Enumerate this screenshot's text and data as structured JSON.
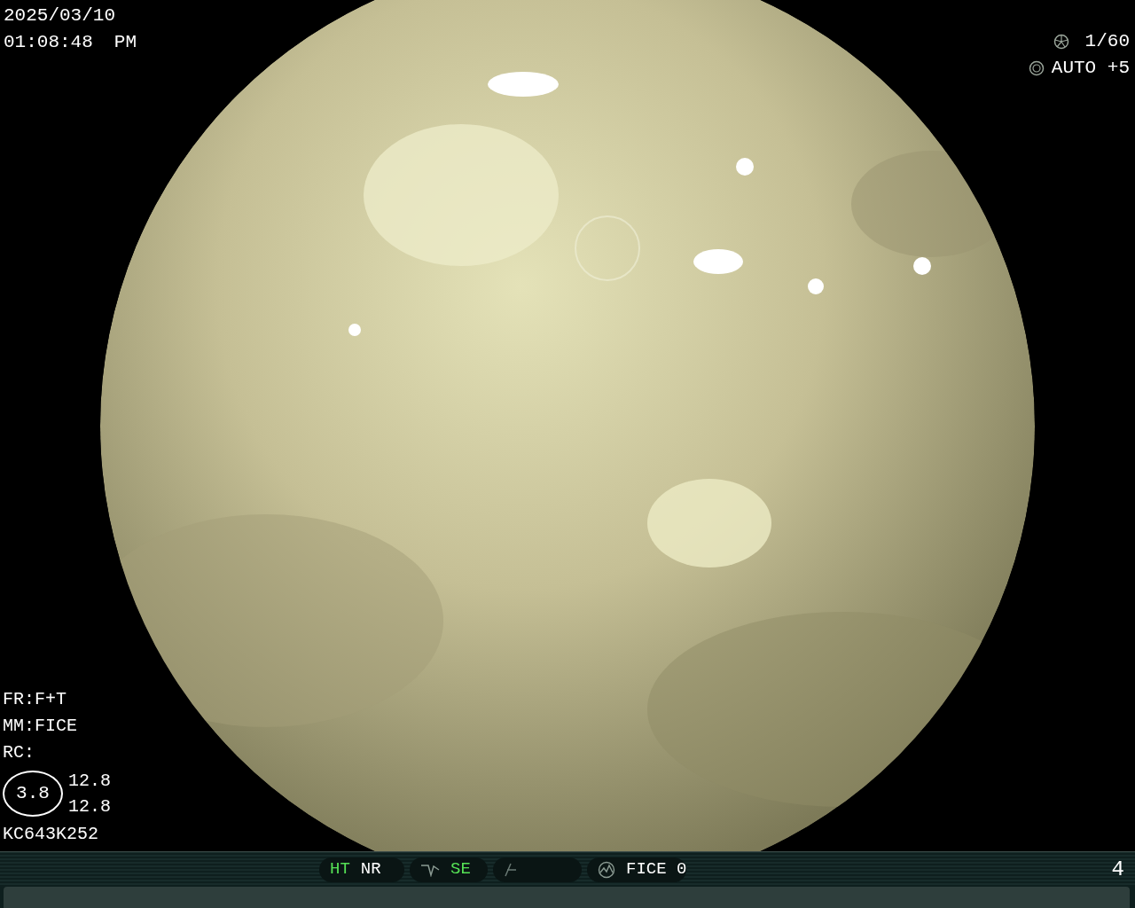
{
  "datetime": {
    "date": "2025/03/10",
    "time": "01:08:48",
    "meridiem": "PM"
  },
  "exposure": {
    "shutter": "1/60",
    "iris": "AUTO +5"
  },
  "settings": [
    "FR:F+T",
    "MM:FICE",
    "RC:"
  ],
  "zoom_gauge": {
    "value": "3.8",
    "readings": [
      "12.8",
      "12.8"
    ]
  },
  "scope_id": "KC643K252",
  "status_bar": {
    "groups": [
      {
        "kind": "plain",
        "items": [
          {
            "label": "HT",
            "active": true
          },
          {
            "label": "NR",
            "active": false
          }
        ]
      },
      {
        "kind": "curve",
        "items": [
          {
            "label": "SE",
            "active": true
          }
        ]
      },
      {
        "kind": "slash"
      },
      {
        "kind": "wave",
        "items": [
          {
            "label": "FICE 0",
            "active": false
          }
        ]
      }
    ],
    "page": "4"
  }
}
